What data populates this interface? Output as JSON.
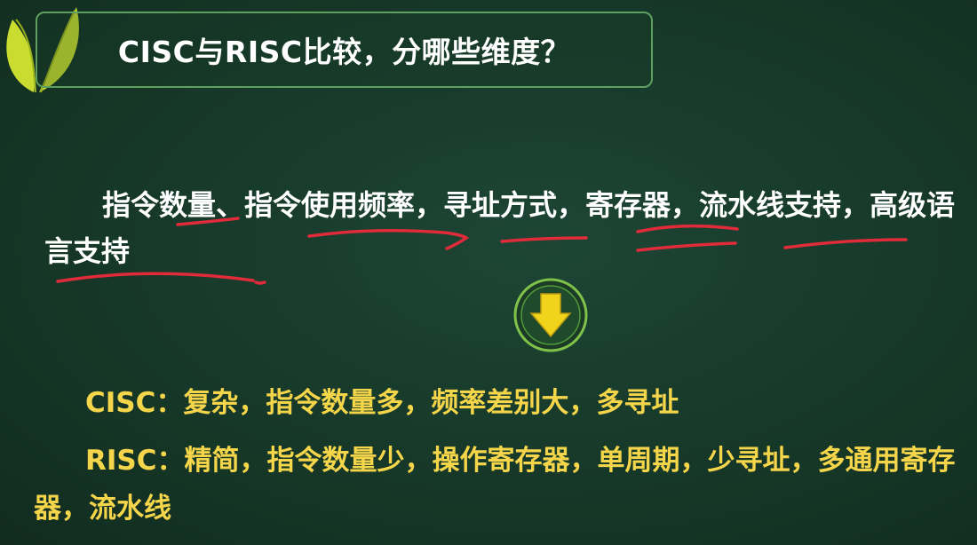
{
  "title": "CISC与RISC比较，分哪些维度？",
  "dimensions_text": "指令数量、指令使用频率，寻址方式，寄存器，流水线支持，高级语言支持",
  "cisc": {
    "label": "CISC：",
    "text": "复杂，指令数量多，频率差别大，多寻址"
  },
  "risc": {
    "label": "RISC：",
    "text": "精简，指令数量少，操作寄存器，单周期，少寻址，多通用寄存器，流水线"
  },
  "colors": {
    "background": "#173a2c",
    "title_border": "#5fa060",
    "underline": "#e02b3a",
    "answer_text": "#f5d54a",
    "arrow": "#f2d31b"
  },
  "icons": {
    "logo": "leaf-logo-icon",
    "arrow": "down-arrow-icon"
  }
}
